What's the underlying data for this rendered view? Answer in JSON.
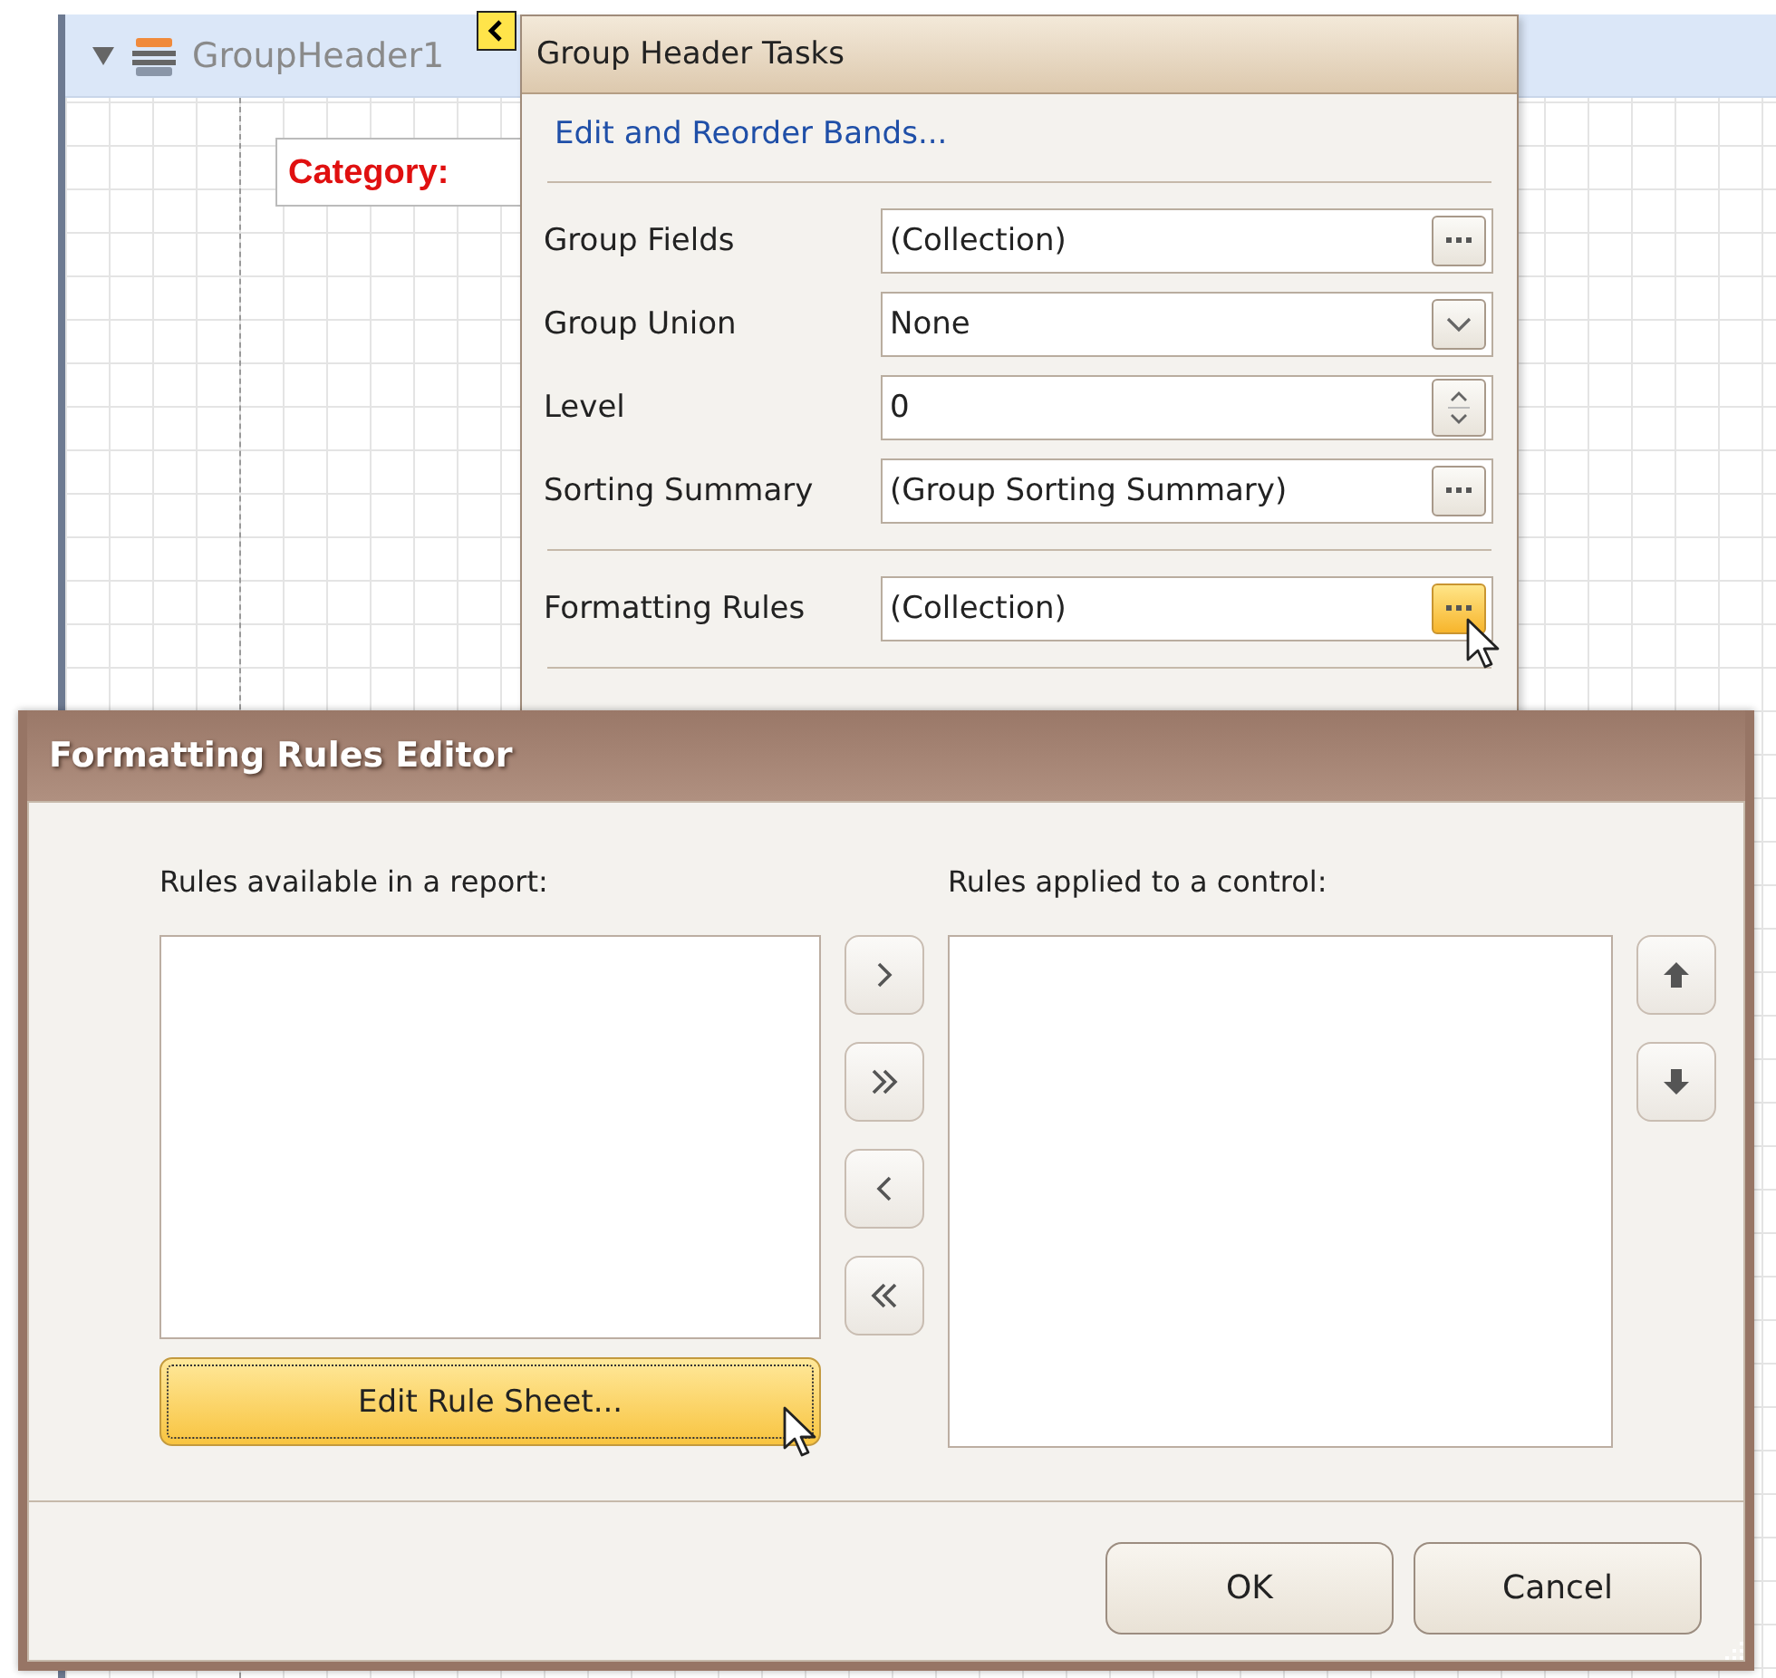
{
  "designer": {
    "band": {
      "title": "GroupHeader1",
      "expanded": true
    },
    "label": "Category:"
  },
  "task_panel": {
    "title": "Group Header Tasks",
    "link": "Edit and Reorder Bands...",
    "groups": [
      [
        {
          "label": "Group Fields",
          "value": "(Collection)",
          "kind": "ellipsis",
          "hot": false
        },
        {
          "label": "Group Union",
          "value": "None",
          "kind": "dropdown",
          "hot": false
        },
        {
          "label": "Level",
          "value": "0",
          "kind": "spin",
          "hot": false
        },
        {
          "label": "Sorting Summary",
          "value": "(Group Sorting Summary)",
          "kind": "ellipsis",
          "hot": false
        }
      ],
      [
        {
          "label": "Formatting Rules",
          "value": "(Collection)",
          "kind": "ellipsis",
          "hot": true
        }
      ]
    ]
  },
  "dialog": {
    "title": "Formatting Rules Editor",
    "available_label": "Rules available in a report:",
    "applied_label": "Rules applied to a control:",
    "edit_button": {
      "label": "Edit Rule Sheet...",
      "hot": true
    },
    "transfer_buttons": [
      {
        "kind": "add"
      },
      {
        "kind": "add_all"
      },
      {
        "kind": "remove"
      },
      {
        "kind": "remove_all"
      }
    ],
    "order_buttons": [
      {
        "kind": "up"
      },
      {
        "kind": "down"
      }
    ],
    "buttons": [
      "OK",
      "Cancel"
    ]
  }
}
